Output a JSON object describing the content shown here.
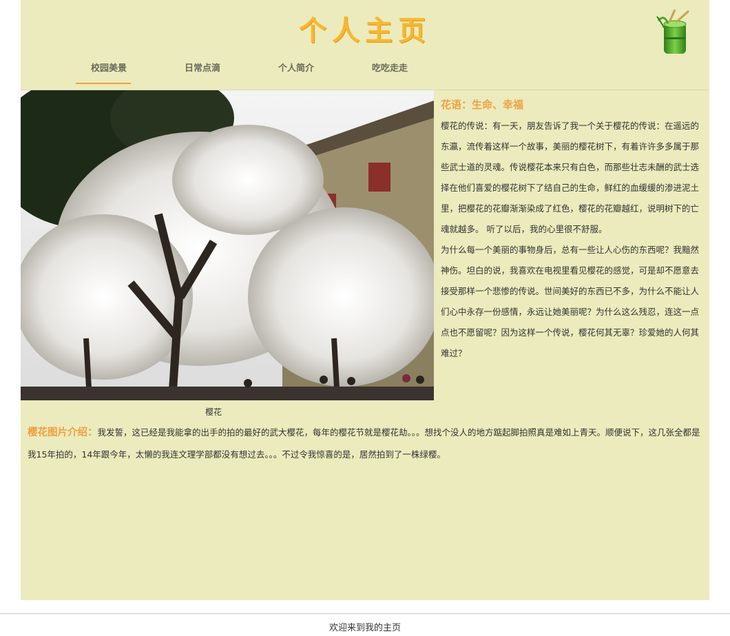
{
  "header": {
    "title": "个人主页",
    "logo_icon": "bamboo-icon"
  },
  "nav": {
    "items": [
      {
        "label": "校园美景",
        "active": true
      },
      {
        "label": "日常点滴",
        "active": false
      },
      {
        "label": "个人简介",
        "active": false
      },
      {
        "label": "吃吃走走",
        "active": false
      }
    ]
  },
  "main": {
    "photo_caption": "樱花",
    "side_title": "花语：生命、幸福",
    "side_paragraphs": [
      "樱花的传说：有一天，朋友告诉了我一个关于樱花的传说：在遥远的东瀛，流传着这样一个故事，美丽的樱花树下，有着许许多多属于那些武士道的灵魂。传说樱花本来只有白色，而那些壮志未酬的武士选择在他们喜爱的樱花树下了结自己的生命，鲜红的血缓缓的渗进泥土里，把樱花的花瓣渐渐染成了红色，樱花的花瓣越红，说明树下的亡魂就越多。 听了以后，我的心里很不舒服。",
      "为什么每一个美丽的事物身后，总有一些让人心伤的东西呢？我黯然神伤。坦白的说，我喜欢在电视里看见樱花的感觉，可是却不愿意去接受那样一个悲惨的传说。世间美好的东西已不多，为什么不能让人们心中永存一份感情，永远让她美丽呢？为什么这么残忍，连这一点点也不愿留呢？因为这样一个传说，樱花何其无辜？珍爱她的人何其难过？"
    ],
    "intro_label": "樱花图片介绍：",
    "intro_text": "我发誓，这已经是我能拿的出手的拍的最好的武大樱花，每年的樱花节就是樱花劫。。。想找个没人的地方踮起脚拍照真是难如上青天。顺便说下，这几张全都是我15年拍的，14年跟今年，太懒的我连文理学部都没有想过去。。。不过令我惊喜的是，居然拍到了一株绿樱。"
  },
  "footer": {
    "text": "欢迎来到我的主页"
  },
  "colors": {
    "page_bg": "#ebebbd",
    "accent": "#f0a040",
    "title": "#f7b731"
  }
}
